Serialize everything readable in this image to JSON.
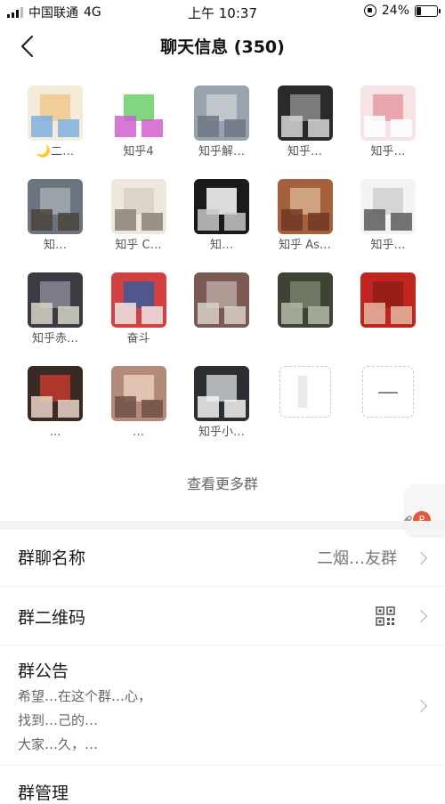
{
  "status_bar": {
    "carrier": "中国联通",
    "network": "4G",
    "time": "上午 10:37",
    "battery_percent": "24%",
    "battery_level": 0.24
  },
  "nav": {
    "back_icon": "chevron-left-icon",
    "title": "聊天信息 (350)"
  },
  "members": [
    {
      "name": "🌙二…",
      "colors": [
        "#f4ecd8",
        "#f0c88c",
        "#7fb0e0"
      ]
    },
    {
      "name": "知乎4",
      "colors": [
        "#ffffff",
        "#6ad06a",
        "#d060d0"
      ]
    },
    {
      "name": "知乎解…",
      "colors": [
        "#9aa3ad",
        "#c9cdd2",
        "#6d7782"
      ]
    },
    {
      "name": "知乎…",
      "colors": [
        "#2a2a2a",
        "#8a8a8a",
        "#d6d6d6"
      ]
    },
    {
      "name": "知乎…",
      "colors": [
        "#f6e3e6",
        "#e89aa5",
        "#ffffff"
      ]
    },
    {
      "name": "知…",
      "colors": [
        "#6a7480",
        "#a4aab2",
        "#4e4438"
      ]
    },
    {
      "name": "知乎 C…",
      "colors": [
        "#efe6dc",
        "#d9cfc4",
        "#8b8178"
      ]
    },
    {
      "name": "知…",
      "colors": [
        "#1a1a1a",
        "#ffffff",
        "#c8c8c8"
      ]
    },
    {
      "name": "知乎 As…",
      "colors": [
        "#a5613e",
        "#d7b08c",
        "#6e3a22"
      ]
    },
    {
      "name": "知乎…",
      "colors": [
        "#f3f3f3",
        "#cfcfcf",
        "#5a5a5a"
      ]
    },
    {
      "name": "知乎赤…",
      "colors": [
        "#3e3a44",
        "#8a8894",
        "#d6d3c8"
      ]
    },
    {
      "name": "奋斗",
      "colors": [
        "#d24040",
        "#3c5a9c",
        "#f1e6e6"
      ]
    },
    {
      "name": "",
      "colors": [
        "#7a5a52",
        "#b9a6a2",
        "#d8d1c9"
      ]
    },
    {
      "name": "",
      "colors": [
        "#3e4434",
        "#77806a",
        "#b3b7a7"
      ]
    },
    {
      "name": "",
      "colors": [
        "#c0261f",
        "#8f1f18",
        "#e4b8a2"
      ]
    },
    {
      "name": "…",
      "colors": [
        "#3a2a26",
        "#c2392e",
        "#e8d2c6"
      ]
    },
    {
      "name": "…",
      "colors": [
        "#b48a78",
        "#e7cbbd",
        "#6f5046"
      ]
    },
    {
      "name": "知乎小…",
      "colors": [
        "#2b2f33",
        "#c7cdd1",
        "#f2f2f2"
      ]
    }
  ],
  "add_member_icon": "plus-icon",
  "remove_member_icon": "minus-icon",
  "see_more": "查看更多群",
  "floating_widget": {
    "badge": "P",
    "icon": "link-icon"
  },
  "settings": {
    "group_name": {
      "label": "群聊名称",
      "value": "二烟…友群"
    },
    "group_qr": {
      "label": "群二维码",
      "icon": "qr-code-icon"
    },
    "group_notice": {
      "label": "群公告",
      "lines": [
        "希望…在这个群…心，",
        "找到…己的…",
        "大家…久，…"
      ]
    },
    "group_manage": {
      "label": "群管理"
    }
  }
}
